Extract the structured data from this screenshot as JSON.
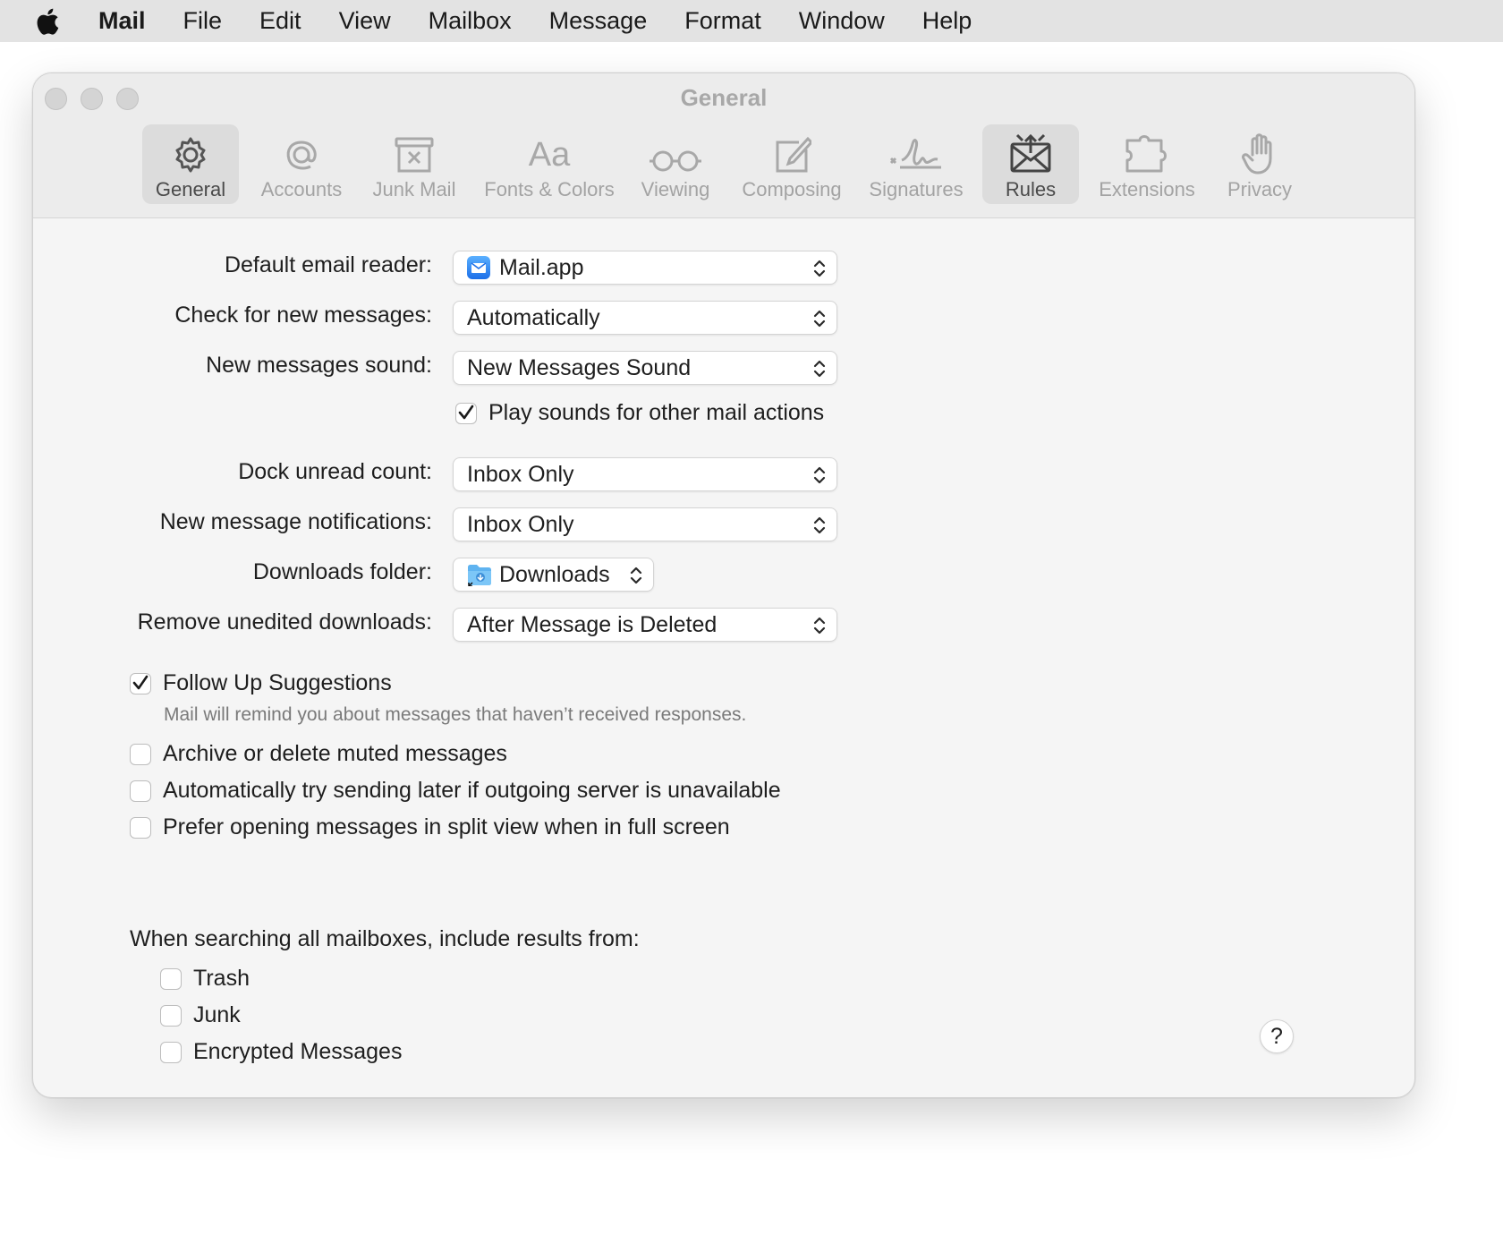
{
  "menubar": {
    "apple_icon": "apple-logo-icon",
    "items": [
      "Mail",
      "File",
      "Edit",
      "View",
      "Mailbox",
      "Message",
      "Format",
      "Window",
      "Help"
    ]
  },
  "window": {
    "title": "General",
    "tabs": [
      {
        "label": "General",
        "icon": "gear-icon",
        "selected": true
      },
      {
        "label": "Accounts",
        "icon": "at-sign-icon",
        "selected": false
      },
      {
        "label": "Junk Mail",
        "icon": "junk-bin-icon",
        "selected": false
      },
      {
        "label": "Fonts & Colors",
        "icon": "font-aa-icon",
        "selected": false
      },
      {
        "label": "Viewing",
        "icon": "glasses-icon",
        "selected": false
      },
      {
        "label": "Composing",
        "icon": "compose-pencil-icon",
        "selected": false
      },
      {
        "label": "Signatures",
        "icon": "signature-icon",
        "selected": false
      },
      {
        "label": "Rules",
        "icon": "envelope-rules-icon",
        "selected": true
      },
      {
        "label": "Extensions",
        "icon": "puzzle-piece-icon",
        "selected": false
      },
      {
        "label": "Privacy",
        "icon": "hand-icon",
        "selected": false
      }
    ]
  },
  "settings": {
    "default_reader": {
      "label": "Default email reader:",
      "value": "Mail.app",
      "icon": "mail-app-icon"
    },
    "check_messages": {
      "label": "Check for new messages:",
      "value": "Automatically"
    },
    "new_sound": {
      "label": "New messages sound:",
      "value": "New Messages Sound"
    },
    "play_sounds": {
      "label": "Play sounds for other mail actions",
      "checked": true
    },
    "dock_count": {
      "label": "Dock unread count:",
      "value": "Inbox Only"
    },
    "notifications": {
      "label": "New message notifications:",
      "value": "Inbox Only"
    },
    "downloads_folder": {
      "label": "Downloads folder:",
      "value": "Downloads",
      "icon": "downloads-folder-icon"
    },
    "remove_downloads": {
      "label": "Remove unedited downloads:",
      "value": "After Message is Deleted"
    },
    "follow_up": {
      "label": "Follow Up Suggestions",
      "checked": true,
      "hint": "Mail will remind you about messages that haven’t received responses."
    },
    "archive_muted": {
      "label": "Archive or delete muted messages",
      "checked": false
    },
    "send_later": {
      "label": "Automatically try sending later if outgoing server is unavailable",
      "checked": false
    },
    "split_view": {
      "label": "Prefer opening messages in split view when in full screen",
      "checked": false
    },
    "search": {
      "title": "When searching all mailboxes, include results from:",
      "trash": {
        "label": "Trash",
        "checked": false
      },
      "junk": {
        "label": "Junk",
        "checked": false
      },
      "encrypted": {
        "label": "Encrypted Messages",
        "checked": false
      }
    },
    "help_label": "?"
  },
  "colors": {
    "selected_tab_bg": "#dcdcdc",
    "inactive_tab": "#a3a3a3",
    "menubar_bg": "#e3e3e3"
  }
}
